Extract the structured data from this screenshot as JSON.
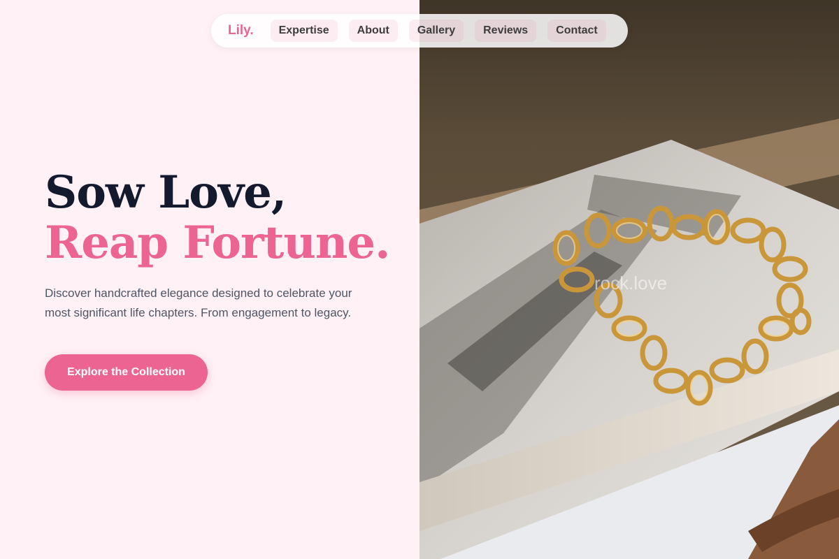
{
  "nav": {
    "brand": "Lily.",
    "items": [
      "Expertise",
      "About",
      "Gallery",
      "Reviews",
      "Contact"
    ]
  },
  "hero": {
    "headline_line1": "Sow Love,",
    "headline_line2": "Reap Fortune.",
    "description": "Discover handcrafted elegance designed to celebrate your most significant life chapters. From engagement to legacy.",
    "cta_label": "Explore the Collection"
  },
  "image": {
    "subject": "gold chain bracelet on open magazine",
    "watermark": "rock.love"
  },
  "colors": {
    "accent": "#ec6592",
    "heading": "#141a2e",
    "background": "#fff1f5",
    "body_text": "#4f5565"
  }
}
